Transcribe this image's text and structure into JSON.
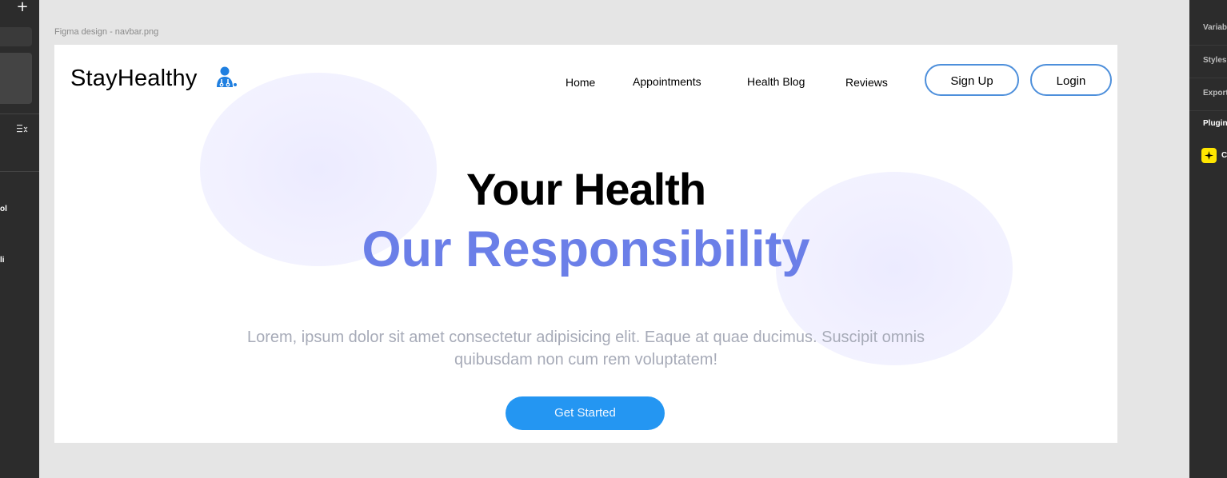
{
  "left_panel": {
    "add_icon": "plus-icon",
    "list_icon": "list-filter-icon",
    "items": [
      "ol",
      "li"
    ]
  },
  "right_panel": {
    "rows": [
      "Variables",
      "Styles",
      "Export",
      "Plugins"
    ],
    "plugin_icon": "plugin-sparkle-icon",
    "plugin_label": "C"
  },
  "canvas": {
    "frame_label": "Figma design - navbar.png"
  },
  "navbar": {
    "logo_text": "StayHealthy",
    "logo_icon": "doctor-icon",
    "links": [
      "Home",
      "Appointments",
      "Health Blog",
      "Reviews"
    ],
    "signup_label": "Sign Up",
    "login_label": "Login"
  },
  "hero": {
    "title": "Your Health",
    "subtitle": "Our Responsibility",
    "description_line1": "Lorem, ipsum dolor sit amet consectetur adipisicing elit. Eaque at quae ducimus. Suscipit omnis",
    "description_line2": "quibusdam non cum rem voluptatem!",
    "cta_label": "Get Started"
  },
  "colors": {
    "brand_blue": "#2496f2",
    "accent_purple": "#6b7fe8",
    "button_border": "#4d8fdb",
    "panel_bg": "#2c2c2c",
    "canvas_bg": "#e5e5e5"
  }
}
